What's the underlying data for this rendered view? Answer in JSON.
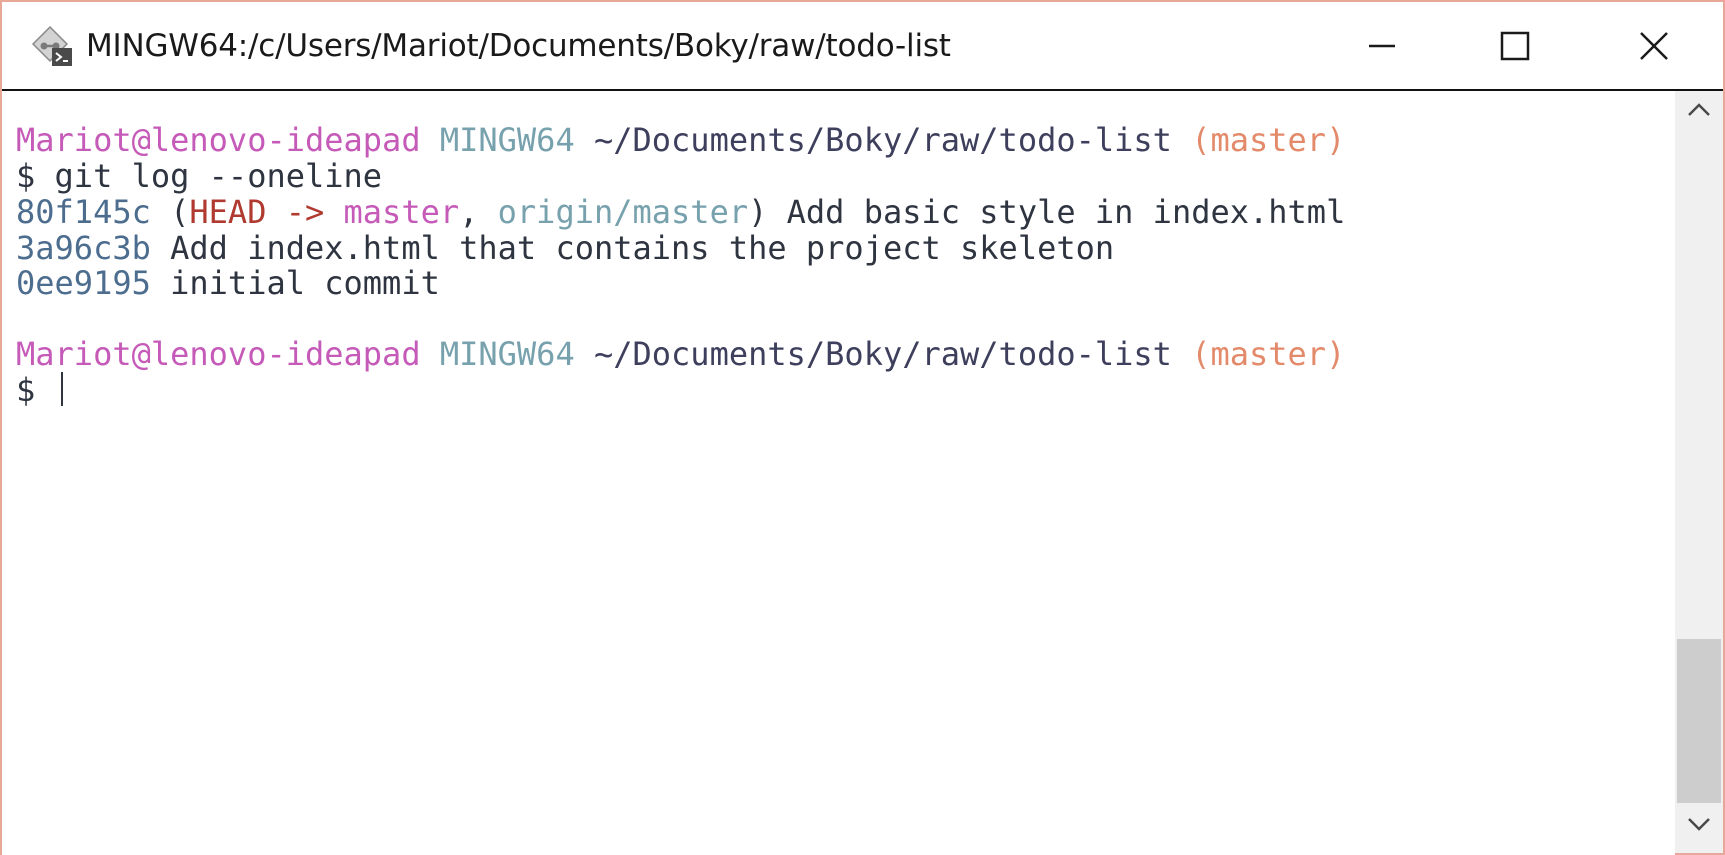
{
  "window": {
    "title": "MINGW64:/c/Users/Mariot/Documents/Boky/raw/todo-list",
    "icon": "git-bash-icon",
    "controls": [
      "minimize-icon",
      "maximize-icon",
      "close-icon"
    ]
  },
  "terminal": {
    "prompt1": {
      "user": "Mariot@lenovo-ideapad",
      "system": "MINGW64",
      "path": "~/Documents/Boky/raw/todo-list",
      "branch": "(master)"
    },
    "command1": "$ git log --oneline",
    "log": [
      {
        "hash": "80f145c",
        "open": " (",
        "head": "HEAD ->",
        "sp": " ",
        "master": "master",
        "comma": ", ",
        "origin": "origin/master",
        "close": ")",
        "message": " Add basic style in index.html"
      },
      {
        "hash": "3a96c3b",
        "message": " Add index.html that contains the project skeleton"
      },
      {
        "hash": "0ee9195",
        "message": " initial commit"
      }
    ],
    "prompt2": {
      "user": "Mariot@lenovo-ideapad",
      "system": "MINGW64",
      "path": "~/Documents/Boky/raw/todo-list",
      "branch": "(master)"
    },
    "command2": "$ "
  },
  "colors": {
    "user": "#c55ab8",
    "system": "#76a1ad",
    "path": "#3d3f5c",
    "branch": "#e38a6a",
    "head": "#b03a30",
    "window_border": "#e8a798"
  }
}
